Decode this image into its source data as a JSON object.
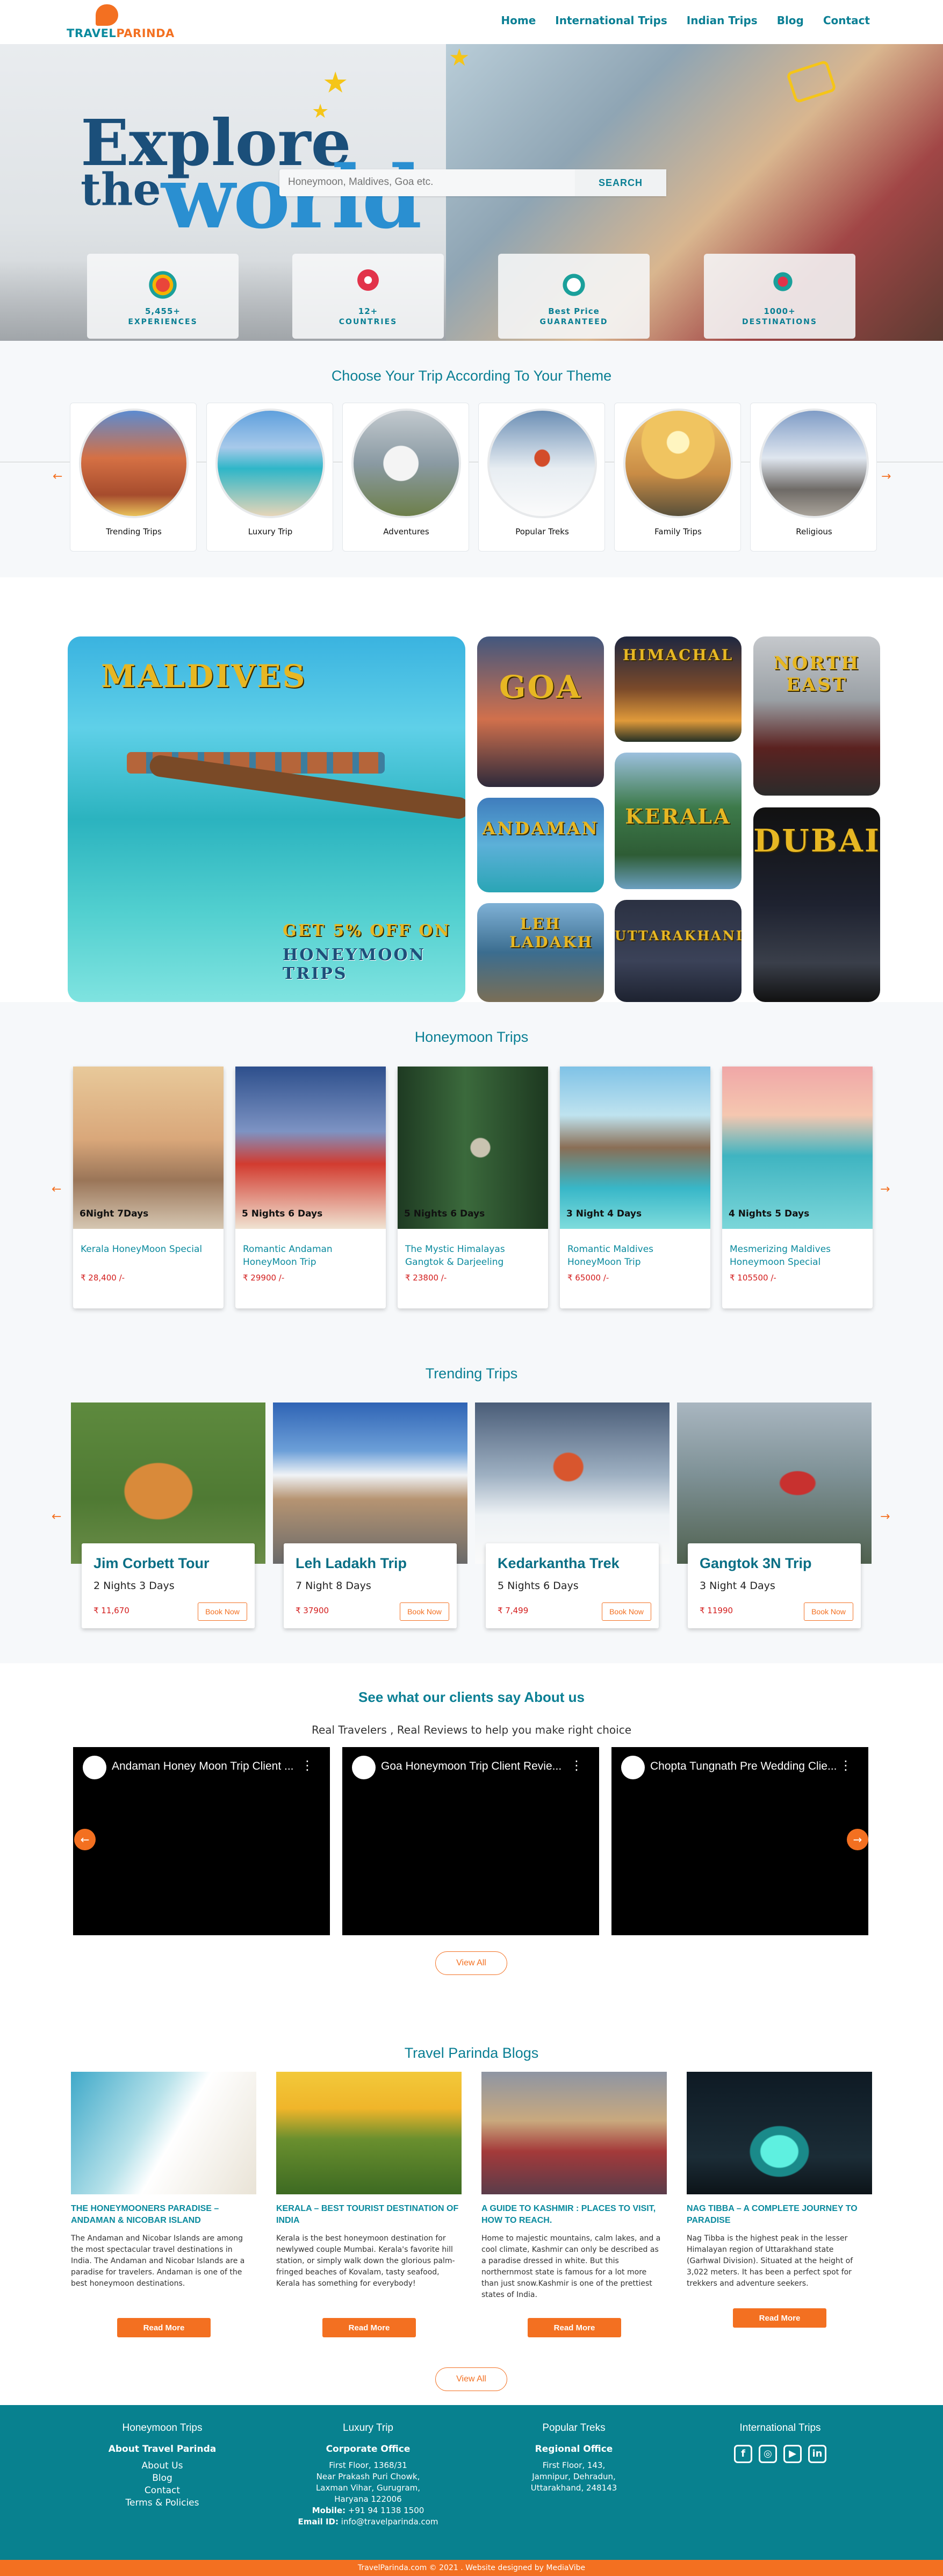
{
  "nav": {
    "brand": "TRAVEL",
    "brand_accent": "PARINDA",
    "links": [
      "Home",
      "International Trips",
      "Indian Trips",
      "Blog",
      "Contact"
    ]
  },
  "hero": {
    "headline_1": "Explore",
    "headline_2": "the",
    "headline_3": "world",
    "search_placeholder": "Honeymoon, Maldives, Goa etc.",
    "search_button": "SEARCH",
    "stats": [
      {
        "value": "5,455+",
        "label": "EXPERIENCES",
        "icon": "balloon-icon"
      },
      {
        "value": "12+",
        "label": "COUNTRIES",
        "icon": "location-pin-icon"
      },
      {
        "value": "Best Price",
        "label": "GUARANTEED",
        "icon": "price-tag-icon"
      },
      {
        "value": "1000+",
        "label": "DESTINATIONS",
        "icon": "map-route-icon"
      }
    ]
  },
  "themes": {
    "title": "Choose Your Trip According To Your Theme",
    "items": [
      "Trending Trips",
      "Luxury Trip",
      "Adventures",
      "Popular Treks",
      "Family Trips",
      "Religious"
    ]
  },
  "destinations": {
    "featured": "MALDIVES",
    "offer_line_1": "GET 5% OFF ON",
    "offer_line_2": "HONEYMOON TRIPS",
    "tiles": [
      "GOA",
      "HIMACHAL",
      "NORTH EAST",
      "ANDAMAN",
      "KERALA",
      "DUBAI",
      "LEH LADAKH",
      "UTTARAKHAND"
    ]
  },
  "honeymoon": {
    "title": "Honeymoon Trips",
    "cards": [
      {
        "duration": "6Night 7Days",
        "name": "Kerala HoneyMoon Special",
        "price": "₹ 28,400 /-"
      },
      {
        "duration": "5 Nights 6 Days",
        "name": "Romantic Andaman HoneyMoon Trip",
        "price": "₹ 29900 /-"
      },
      {
        "duration": "5 Nights 6 Days",
        "name": "The Mystic Himalayas Gangtok & Darjeeling",
        "price": "₹ 23800 /-"
      },
      {
        "duration": "3 Night 4 Days",
        "name": "Romantic Maldives HoneyMoon Trip",
        "price": "₹ 65000 /-"
      },
      {
        "duration": "4 Nights 5 Days",
        "name": "Mesmerizing Maldives Honeymoon Special",
        "price": "₹ 105500 /-"
      }
    ]
  },
  "trending": {
    "title": "Trending Trips",
    "book_label": "Book Now",
    "cards": [
      {
        "name": "Jim Corbett Tour",
        "duration": "2 Nights 3 Days",
        "price": "₹ 11,670"
      },
      {
        "name": "Leh Ladakh Trip",
        "duration": "7 Night 8 Days",
        "price": "₹ 37900"
      },
      {
        "name": "Kedarkantha Trek",
        "duration": "5 Nights 6 Days",
        "price": "₹ 7,499"
      },
      {
        "name": "Gangtok 3N Trip",
        "duration": "3 Night 4 Days",
        "price": "₹ 11990"
      }
    ]
  },
  "reviews": {
    "title": "See what our clients say About us",
    "subtitle": "Real Travelers , Real Reviews to help you make right choice",
    "videos": [
      "Andaman Honey Moon Trip Client ...",
      "Goa Honeymoon Trip Client Revie...",
      "Chopta Tungnath Pre Wedding Clie..."
    ],
    "view_all": "View All"
  },
  "blogs": {
    "title": "Travel Parinda Blogs",
    "read_more": "Read More",
    "view_all": "View All",
    "posts": [
      {
        "title": "THE HONEYMOONERS PARADISE – ANDAMAN & NICOBAR ISLAND",
        "excerpt": "The Andaman and Nicobar Islands are among the most spectacular travel destinations in India. The Andaman and Nicobar Islands are a paradise for travelers. Andaman is one of the best honeymoon destinations."
      },
      {
        "title": "KERALA – BEST TOURIST DESTINATION OF INDIA",
        "excerpt": "Kerala is the best honeymoon destination for newlywed couple Mumbai. Kerala's favorite hill station, or simply walk down the glorious palm-fringed beaches of Kovalam, tasty seafood, Kerala has something for everybody!"
      },
      {
        "title": "A GUIDE TO KASHMIR : PLACES TO VISIT, HOW TO REACH.",
        "excerpt": "Home to majestic mountains, calm lakes, and a cool climate, Kashmir can only be described as a paradise dressed in white. But this northernmost state is famous for a lot more than just snow.Kashmir is one of the prettiest states of India."
      },
      {
        "title": "NAG TIBBA – A COMPLETE JOURNEY TO PARADISE",
        "excerpt": "Nag Tibba is the highest peak in the lesser Himalayan region of Uttarakhand state (Garhwal Division). Situated at the height of 3,022 meters. It has been a perfect spot for trekkers and adventure seekers."
      }
    ]
  },
  "footer": {
    "col1_title": "Honeymoon Trips",
    "col1_heading": "About Travel Parinda",
    "col1_links": [
      "About Us",
      "Blog",
      "Contact",
      "Terms & Policies"
    ],
    "col2_title": "Luxury Trip",
    "col2_heading": "Corporate Office",
    "col2_lines": [
      "First Floor, 1368/31",
      "Near Prakash Puri Chowk,",
      "Laxman Vihar, Gurugram,",
      "Haryana 122006"
    ],
    "col2_mobile_label": "Mobile:",
    "col2_mobile": "+91 94 1138 1500",
    "col2_email_label": "Email ID:",
    "col2_email": "info@travelparinda.com",
    "col3_title": "Popular Treks",
    "col3_heading": "Regional Office",
    "col3_lines": [
      "First Floor, 143,",
      "Jamnipur, Dehradun,",
      "Uttarakhand, 248143"
    ],
    "col4_title": "International Trips",
    "social": [
      "facebook-icon",
      "instagram-icon",
      "youtube-icon",
      "linkedin-icon"
    ],
    "copyright": "TravelParinda.com © 2021 . Website designed by MediaVibe"
  },
  "colors": {
    "teal": "#0a7f94",
    "orange": "#f37021",
    "price_red": "#d31c1c",
    "footer": "#08818f"
  }
}
